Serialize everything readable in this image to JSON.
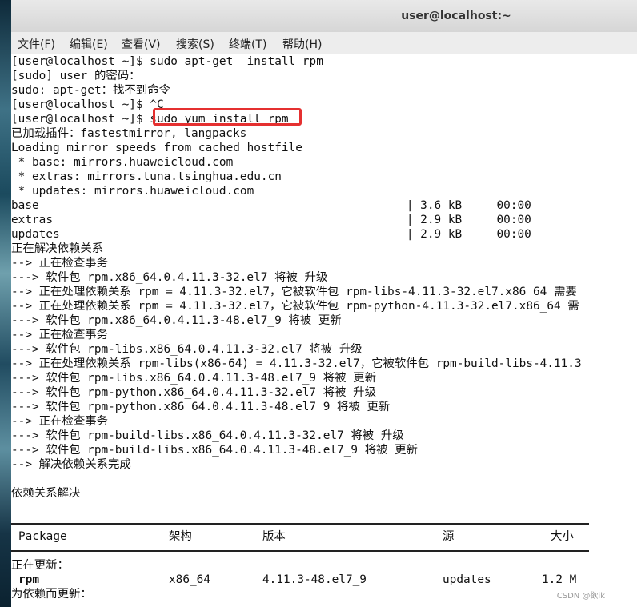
{
  "window": {
    "title": "user@localhost:~"
  },
  "menubar": {
    "items": [
      "文件(F)",
      "编辑(E)",
      "查看(V)",
      "搜索(S)",
      "终端(T)",
      "帮助(H)"
    ]
  },
  "terminal": {
    "lines": [
      "[user@localhost ~]$ sudo apt-get  install rpm",
      "[sudo] user 的密码：",
      "sudo: apt-get：找不到命令",
      "[user@localhost ~]$ ^C",
      "[user@localhost ~]$ sudo yum install rpm",
      "已加载插件：fastestmirror, langpacks",
      "Loading mirror speeds from cached hostfile",
      " * base: mirrors.huaweicloud.com",
      " * extras: mirrors.tuna.tsinghua.edu.cn",
      " * updates: mirrors.huaweicloud.com",
      "base                                                     | 3.6 kB     00:00",
      "extras                                                   | 2.9 kB     00:00",
      "updates                                                  | 2.9 kB     00:00",
      "正在解决依赖关系",
      "--> 正在检查事务",
      "---> 软件包 rpm.x86_64.0.4.11.3-32.el7 将被 升级",
      "--> 正在处理依赖关系 rpm = 4.11.3-32.el7，它被软件包 rpm-libs-4.11.3-32.el7.x86_64 需要",
      "--> 正在处理依赖关系 rpm = 4.11.3-32.el7，它被软件包 rpm-python-4.11.3-32.el7.x86_64 需",
      "---> 软件包 rpm.x86_64.0.4.11.3-48.el7_9 将被 更新",
      "--> 正在检查事务",
      "---> 软件包 rpm-libs.x86_64.0.4.11.3-32.el7 将被 升级",
      "--> 正在处理依赖关系 rpm-libs(x86-64) = 4.11.3-32.el7，它被软件包 rpm-build-libs-4.11.3",
      "---> 软件包 rpm-libs.x86_64.0.4.11.3-48.el7_9 将被 更新",
      "---> 软件包 rpm-python.x86_64.0.4.11.3-32.el7 将被 升级",
      "---> 软件包 rpm-python.x86_64.0.4.11.3-48.el7_9 将被 更新",
      "--> 正在检查事务",
      "---> 软件包 rpm-build-libs.x86_64.0.4.11.3-32.el7 将被 升级",
      "---> 软件包 rpm-build-libs.x86_64.0.4.11.3-48.el7_9 将被 更新",
      "--> 解决依赖关系完成",
      "",
      "依赖关系解决"
    ],
    "table": {
      "headers": [
        "Package",
        "架构",
        "版本",
        "源",
        "大小"
      ],
      "section_updating": "正在更新：",
      "row_rpm": [
        "rpm",
        "x86_64",
        "4.11.3-48.el7_9",
        "updates",
        "1.2 M"
      ],
      "section_dep_updating": "为依赖而更新："
    }
  },
  "watermark": "CSDN @欲ik"
}
